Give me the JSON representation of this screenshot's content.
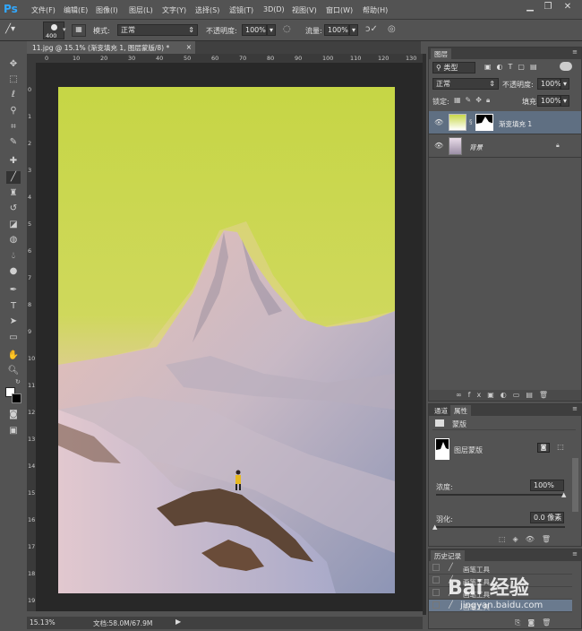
{
  "app": {
    "logo": "Ps"
  },
  "menubar": {
    "items": [
      "文件(F)",
      "编辑(E)",
      "图像(I)",
      "图层(L)",
      "文字(Y)",
      "选择(S)",
      "滤镜(T)",
      "3D(D)",
      "视图(V)",
      "窗口(W)",
      "帮助(H)"
    ],
    "window_controls": [
      "minimize-icon",
      "restore-icon",
      "close-icon"
    ]
  },
  "options": {
    "brush_size": "400",
    "mode_label": "模式:",
    "mode_value": "正常",
    "opacity_label": "不透明度:",
    "opacity_value": "100%",
    "flow_label": "流量:",
    "flow_value": "100%"
  },
  "document": {
    "tab_title": "11.jpg @ 15.1% (渐变填充 1, 图层蒙版/8) *",
    "ruler_top": [
      "0",
      "10",
      "20",
      "30",
      "40",
      "50",
      "60",
      "70",
      "80",
      "90",
      "100",
      "110",
      "120",
      "130"
    ],
    "ruler_left": [
      "0",
      "1",
      "2",
      "3",
      "4",
      "5",
      "6",
      "7",
      "8",
      "9",
      "10",
      "11",
      "12",
      "13",
      "14",
      "15",
      "16",
      "17",
      "18",
      "19"
    ],
    "zoom": "15.13%",
    "doc_size": "文档:58.0M/67.9M"
  },
  "layers_panel": {
    "tab": "图层",
    "filter_kind": "类型",
    "blend_mode": "正常",
    "opacity_label": "不透明度:",
    "opacity_value": "100%",
    "lock_label": "锁定:",
    "fill_label": "填充:",
    "fill_value": "100%",
    "layers": [
      {
        "name": "渐变填充 1",
        "selected": true
      },
      {
        "name": "背景",
        "selected": false
      }
    ]
  },
  "properties_panel": {
    "tabs": [
      "通道",
      "属性"
    ],
    "header": "蒙版",
    "mask_type": "图层蒙版",
    "density_label": "浓度:",
    "density_value": "100%",
    "density_level": 1.0,
    "feather_label": "羽化:",
    "feather_value": "0.0 像素",
    "feather_level": 0.0
  },
  "history_panel": {
    "tab": "历史记录",
    "items": [
      "画笔工具",
      "画笔工具",
      "画笔工具",
      "画笔工具"
    ]
  },
  "watermark": {
    "text": "Bai 经验",
    "url": "jingyan.baidu.com"
  },
  "colors": {
    "ui_bg": "#535353",
    "ui_dark": "#3a3a3a",
    "selected_row": "#5f6f82",
    "ps_blue": "#31a8ff",
    "gradient_top": "#c8d84a",
    "gradient_mid": "#e6c2aa",
    "gradient_bottom": "#9aa0c0"
  }
}
